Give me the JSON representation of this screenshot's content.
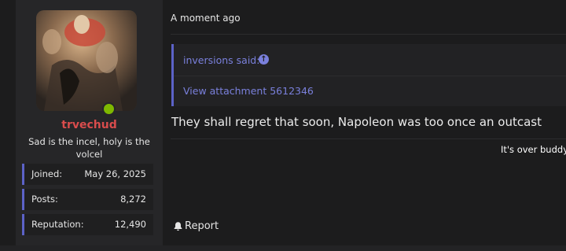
{
  "user": {
    "username": "trvechud",
    "title": "Sad is the incel, holy is the volcel",
    "online_color": "#7fb800",
    "stats": [
      {
        "label": "Joined:",
        "value": "May 26, 2025"
      },
      {
        "label": "Posts:",
        "value": "8,272"
      },
      {
        "label": "Reputation:",
        "value": "12,490"
      }
    ]
  },
  "post": {
    "timestamp": "A moment ago",
    "quote": {
      "author": "inversions said:",
      "arrow_icon": "arrow-up-icon",
      "attachment": "View attachment 5612346"
    },
    "message": "They shall regret that soon, Napoleon was too once an outcast",
    "signature": "It's over buddy I",
    "report_label": "Report",
    "report_icon": "bell-icon"
  },
  "colors": {
    "accent": "#5c62c7",
    "link": "#7a80dc",
    "username": "#d94c4c"
  }
}
